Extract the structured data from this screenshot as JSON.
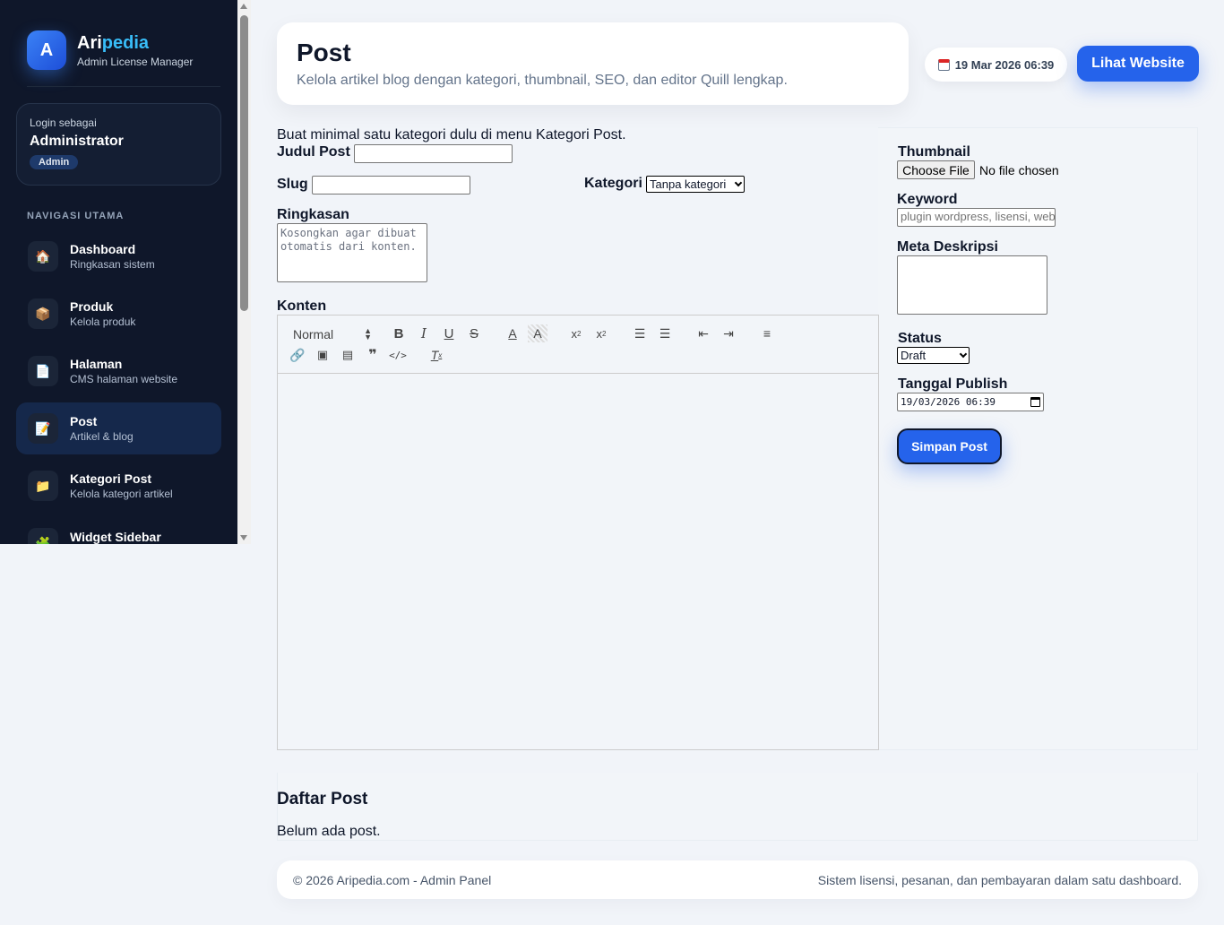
{
  "brand": {
    "logo_letter": "A",
    "name_part1": "Ari",
    "name_part2": "pedia",
    "subtitle": "Admin License Manager"
  },
  "login": {
    "label": "Login sebagai",
    "name": "Administrator",
    "role": "Admin"
  },
  "nav": {
    "heading": "NAVIGASI UTAMA",
    "items": [
      {
        "label": "Dashboard",
        "sub": "Ringkasan sistem",
        "icon": "🏠"
      },
      {
        "label": "Produk",
        "sub": "Kelola produk",
        "icon": "📦"
      },
      {
        "label": "Halaman",
        "sub": "CMS halaman website",
        "icon": "📄"
      },
      {
        "label": "Post",
        "sub": "Artikel & blog",
        "icon": "📝"
      },
      {
        "label": "Kategori Post",
        "sub": "Kelola kategori artikel",
        "icon": "📁"
      },
      {
        "label": "Widget Sidebar",
        "sub": "",
        "icon": "🧩"
      }
    ]
  },
  "header": {
    "title": "Post",
    "description": "Kelola artikel blog dengan kategori, thumbnail, SEO, dan editor Quill lengkap.",
    "datetime": "19 Mar 2026 06:39",
    "site_button": "Lihat Website"
  },
  "form": {
    "notice": "Buat minimal satu kategori dulu di menu Kategori Post.",
    "title_label": "Judul Post",
    "title_value": "",
    "slug_label": "Slug",
    "slug_value": "",
    "category_label": "Kategori",
    "category_selected": "Tanpa kategori",
    "summary_label": "Ringkasan",
    "summary_placeholder": "Kosongkan agar dibuat otomatis dari konten.",
    "content_label": "Konten",
    "editor_format": "Normal",
    "thumbnail_label": "Thumbnail",
    "file_button": "Choose File",
    "file_status": "No file chosen",
    "keyword_label": "Keyword",
    "keyword_placeholder": "plugin wordpress, lisensi, web",
    "meta_label": "Meta Deskripsi",
    "meta_value": "",
    "status_label": "Status",
    "status_selected": "Draft",
    "publish_label": "Tanggal Publish",
    "publish_value": "19/03/2026 06:39",
    "save_button": "Simpan Post"
  },
  "list": {
    "title": "Daftar Post",
    "empty": "Belum ada post."
  },
  "footer": {
    "left": "© 2026 Aripedia.com - Admin Panel",
    "right": "Sistem lisensi, pesanan, dan pembayaran dalam satu dashboard."
  },
  "colors": {
    "sidebar_bg": "#0f172a",
    "accent": "#2563eb",
    "brand_accent": "#38bdf8",
    "page_bg": "#f1f4f9"
  }
}
